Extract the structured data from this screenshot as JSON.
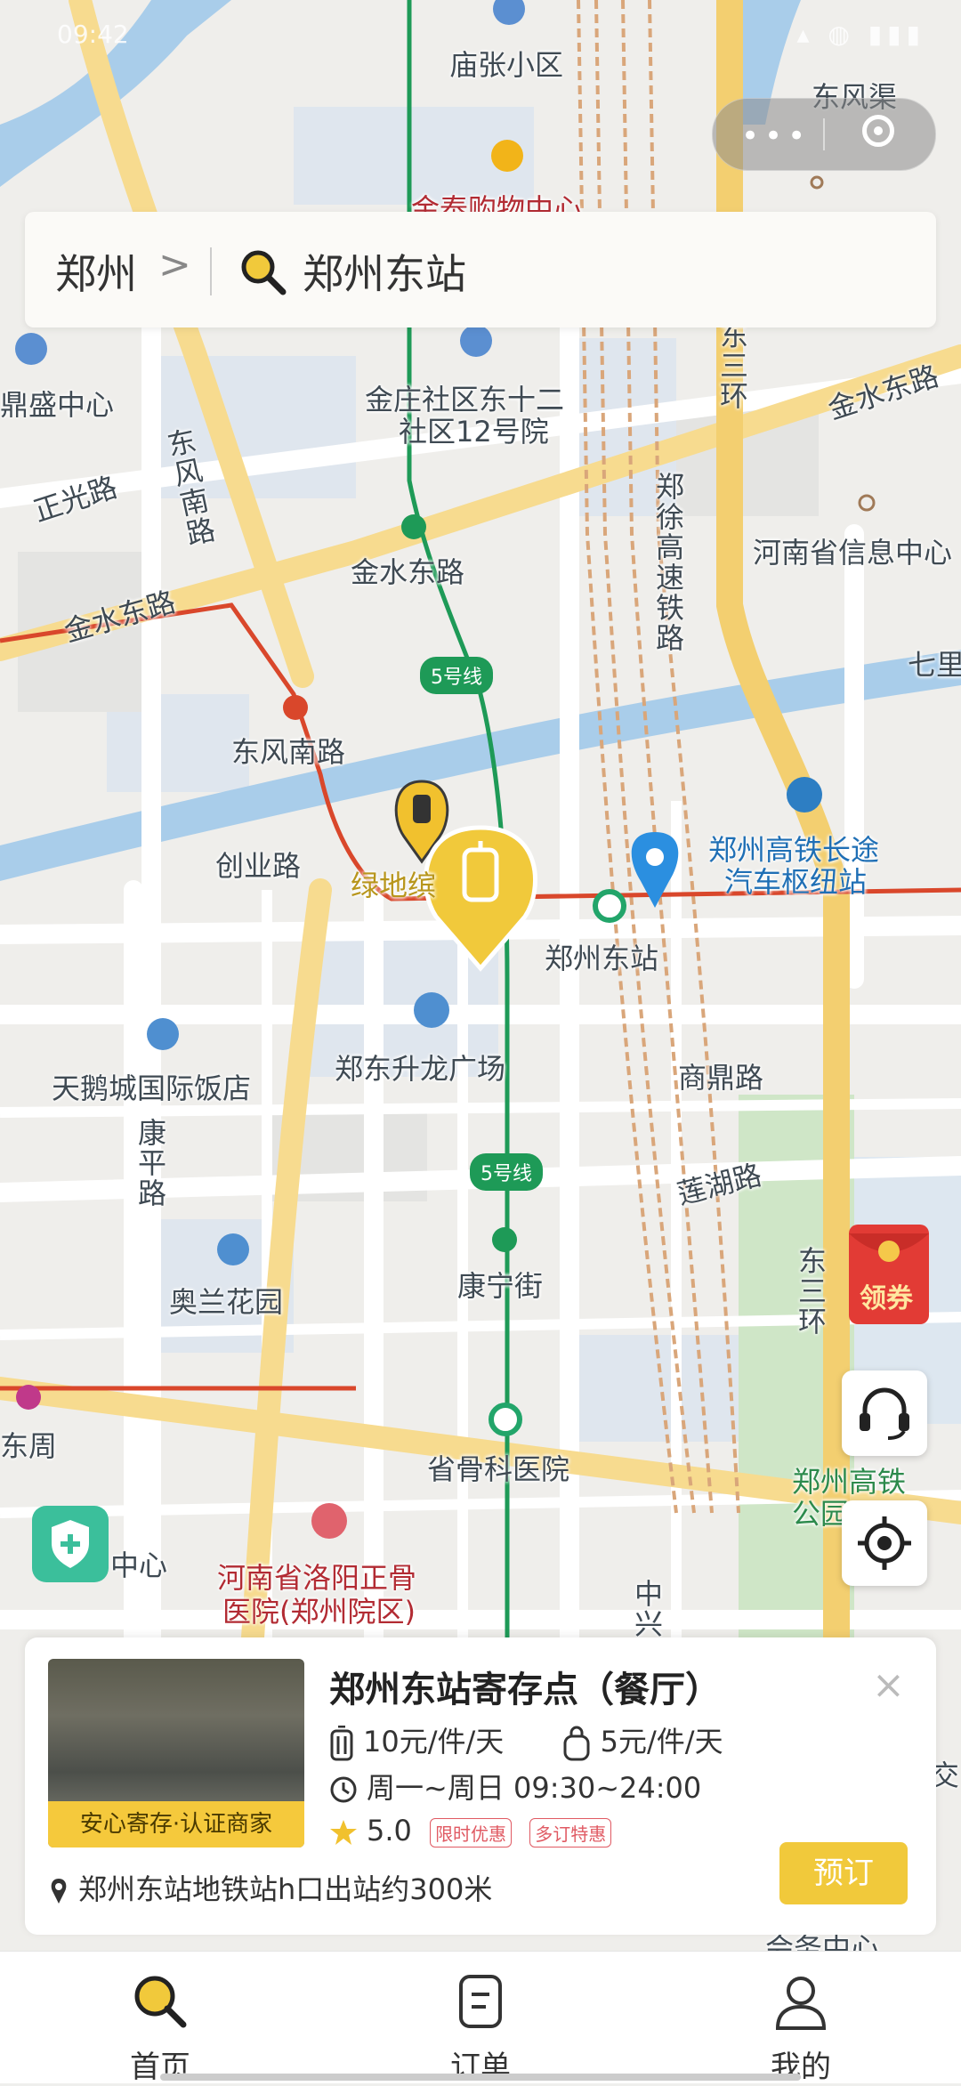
{
  "status_bar": {
    "time": "09:42",
    "icons": "▴ ◍ ▮▮▮"
  },
  "search": {
    "city": "郑州",
    "chevron": ">",
    "query": "郑州东站"
  },
  "map_labels": {
    "miaozhang": "庙张小区",
    "jintai": "金泰购物中心",
    "dongfengqu": "东风渠",
    "dingsheng": "鼎盛中心",
    "jinzhuang": "金庄社区东十二",
    "jinzhuang2": "社区12号院",
    "jinshui_road_ne": "金水东路",
    "zhengguang": "正光路",
    "dongfeng_nanlu_v": "东风南路",
    "zhengxu": "郑徐高速铁路",
    "dongsanhuan_top": "东三环",
    "henan_info": "河南省信息中心",
    "qili": "七里",
    "jinshui_station": "金水东路",
    "jinshui_road_w": "金水东路",
    "line5_a": "5号线",
    "dongfeng_station": "东风南路",
    "chuangye": "创业路",
    "lvdi": "绿地缤",
    "hub1": "郑州高铁长途",
    "hub2": "汽车枢纽站",
    "zhengzhou_east": "郑州东站",
    "tiane": "天鹅城国际饭店",
    "shenglong": "郑东升龙广场",
    "shangding": "商鼎路",
    "kangping": "康平路",
    "line5_b": "5号线",
    "lianhu": "莲湖路",
    "aolan": "奥兰花园",
    "kangning": "康宁街",
    "dongsanhuan_bot": "东三环",
    "dongzhou": "东周",
    "shenggu": "省骨科医院",
    "hst_gongyuan1": "郑州高铁",
    "hst_gongyuan2": "公园",
    "zhongxin": "中心",
    "hospital1": "河南省洛阳正骨",
    "hospital2": "医院(郑州院区)",
    "zhongxing": "中兴",
    "jiao": "交",
    "shangwu": "会务中心"
  },
  "card": {
    "title": "郑州东站寄存点（餐厅）",
    "photo_tag": "安心寄存·认证商家",
    "price_large": "10元/件/天",
    "price_small": "5元/件/天",
    "hours": "周一~周日 09:30~24:00",
    "rating": "5.0",
    "tag1": "限时优惠",
    "tag2": "多订特惠",
    "location": "郑州东站地铁站h口出站约300米",
    "book_label": "预订",
    "close": "×"
  },
  "coupon_label": "领券",
  "tabs": [
    {
      "label": "首页"
    },
    {
      "label": "订单"
    },
    {
      "label": "我的"
    }
  ],
  "colors": {
    "accent": "#f1c93b",
    "metro_green": "#1e9a57",
    "metro_red": "#d9472b",
    "road_yellow": "#f6d98a"
  }
}
